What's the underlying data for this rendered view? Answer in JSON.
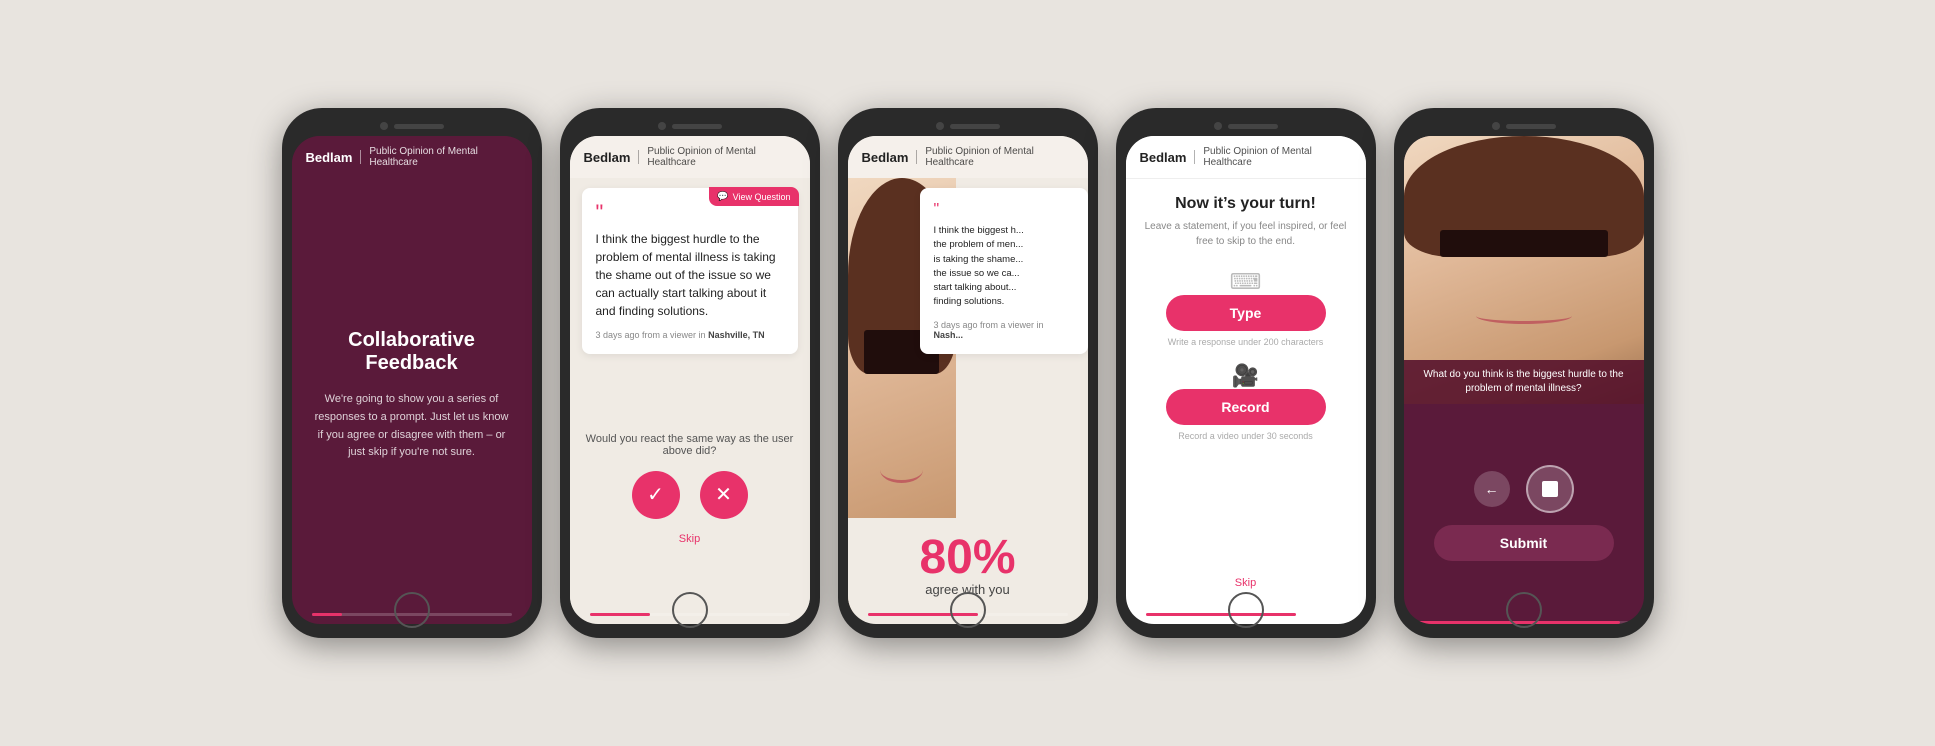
{
  "app": {
    "brand": "Bedlam",
    "divider": "|",
    "subtitle": "Public Opinion of Mental Healthcare"
  },
  "screen1": {
    "title": "Collaborative Feedback",
    "body": "We're going to show you a series of responses to a prompt. Just let us know if you agree or disagree with them – or just skip if you're not sure."
  },
  "screen2": {
    "view_question_label": "View Question",
    "quote_mark": "““",
    "quote_text": "I think the biggest hurdle to the problem of mental illness is taking the shame out of the issue so we can actually start talking about it and finding solutions.",
    "quote_meta": "3 days ago from a viewer in",
    "quote_location": "Nashville, TN",
    "reaction_question": "Would you react the same way\nas the user above did?",
    "skip_label": "Skip"
  },
  "screen3": {
    "quote_mark": "““",
    "quote_text": "I think the biggest h... the problem of men... is taking the shame... the issue so we ca... start talking about... finding solutions.",
    "quote_meta": "3 days ago from a view... in Nas...",
    "stat_percent": "80%",
    "stat_text": "agree with you"
  },
  "screen4": {
    "title": "Now it’s your turn!",
    "subtitle": "Leave a statement, if you feel inspired,\nor feel free to skip to the end.",
    "type_label": "Type",
    "type_helper": "Write a response under 200 characters",
    "record_label": "Record",
    "record_helper": "Record a video under 30 seconds",
    "skip_label": "Skip"
  },
  "screen5": {
    "video_question": "What do you think is the biggest hurdle to the problem of mental illness?",
    "submit_label": "Submit"
  },
  "icons": {
    "check": "✓",
    "x": "✕",
    "back_arrow": "←",
    "video_camera": "🎥",
    "keyboard": "⌨",
    "chat_icon": "💬"
  }
}
